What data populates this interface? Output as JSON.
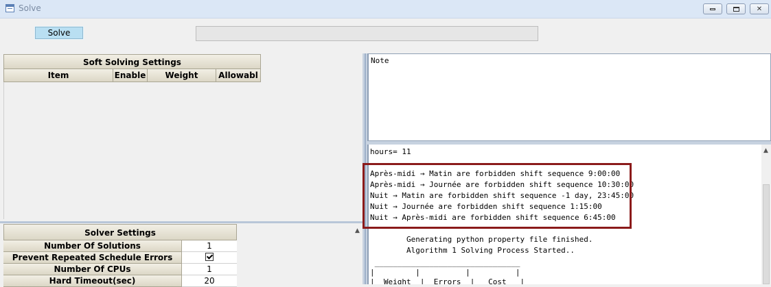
{
  "window": {
    "title": "Solve"
  },
  "toolbar": {
    "solve_label": "Solve",
    "progress": 0
  },
  "soft_settings": {
    "title": "Soft Solving Settings",
    "columns": [
      "Item",
      "Enable",
      "Weight",
      "Allowabl"
    ]
  },
  "solver_settings": {
    "title": "Solver Settings",
    "rows": [
      {
        "label": "Number Of Solutions",
        "value": "1"
      },
      {
        "label": "Prevent Repeated Schedule Errors",
        "value": "",
        "checked": true
      },
      {
        "label": "Number Of CPUs",
        "value": "1"
      },
      {
        "label": "Hard Timeout(sec)",
        "value": "20"
      }
    ]
  },
  "note": {
    "label": "Note"
  },
  "log": {
    "lines": [
      "hours= 11",
      "",
      "Après-midi → Matin are forbidden shift sequence 9:00:00",
      "Après-midi → Journée are forbidden shift sequence 10:30:00",
      "Nuit → Matin are forbidden shift sequence -1 day, 23:45:00",
      "Nuit → Journée are forbidden shift sequence 1:15:00",
      "Nuit → Après-midi are forbidden shift sequence 6:45:00",
      "",
      "        Generating python property file finished.",
      "        Algorithm 1 Solving Process Started..",
      "",
      " ________________________________",
      "|         |          |          |",
      "|  Weight  |  Errors  |   Cost   |"
    ]
  },
  "colors": {
    "highlight": "#8b1a1a",
    "solve_button": "#b9dff2"
  }
}
